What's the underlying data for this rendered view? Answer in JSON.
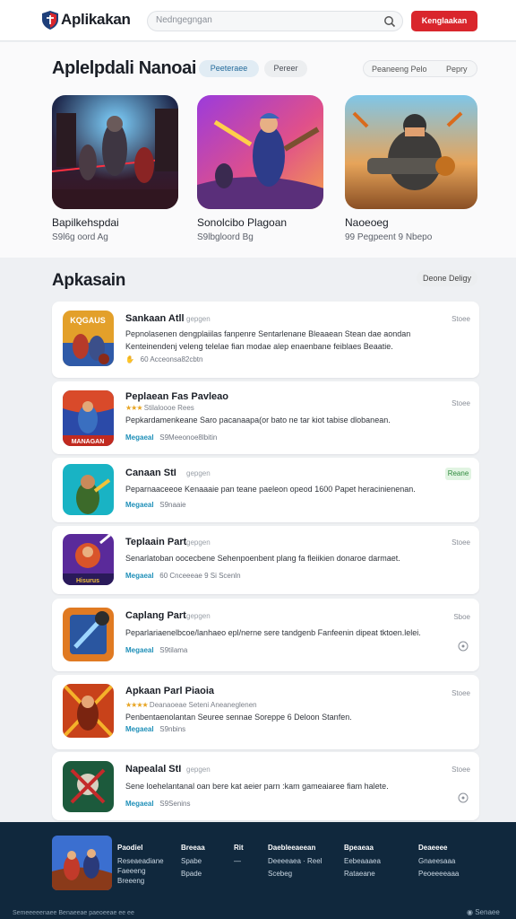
{
  "header": {
    "brand": "Aplikakan",
    "search_placeholder": "Nedngegngan",
    "cta_label": "Kenglaakan"
  },
  "featured": {
    "title": "Aplelpdali Nanoai",
    "pill_active": "Peeteraee",
    "pill_inactive": "Pereer",
    "sort_left": "Peaneeng Pelo",
    "sort_right": "Pepry",
    "cards": [
      {
        "title": "Bapilkehspdai",
        "subtitle": "S9l6g oord Ag"
      },
      {
        "title": "Sonolcibo Plagoan",
        "subtitle": "S9lbgloord Bg"
      },
      {
        "title": "Naoeoeg",
        "subtitle": "99 Pegpeent 9 Nbepo"
      }
    ]
  },
  "list": {
    "title": "Apkasain",
    "sort_label": "Deone Deligy",
    "rows": [
      {
        "icon_label": "KQGAUS",
        "title": "Sankaan Atll",
        "tag": "gepgen",
        "right": "Stoee",
        "desc1": "Pepnolasenen dengplaiilas fanpenre Sentarlenane Bleaaean Stean dae aondan",
        "desc2": "Kenteinendenj veleng telelae fian modae alep enaenbane feiblaes Beaatie.",
        "meta_a": "✋",
        "meta_b": "60 Acceonsa82cbtn"
      },
      {
        "icon_label": "MANAGAN",
        "title": "Peplaean Fas Pavleao",
        "tag": "",
        "right": "Stoee",
        "stars": "★★★",
        "rating": "Stilaloooe Rees",
        "desc1": "Pepkardamenkeane Saro pacanaapa(or bato ne tar kiot tabise dlobanean.",
        "desc2": "",
        "meta_a": "Megaeal",
        "meta_b": "S9Meeonoe8lbitin"
      },
      {
        "icon_label": "",
        "title": "Canaan StI",
        "tag": "gepgen",
        "right": "Reane",
        "desc1": "Peparnaaceeoe Kenaaaie pan teane paeleon opeod 1600 Papet heracinienenan.",
        "desc2": "",
        "meta_a": "Megaeal",
        "meta_b": "S9naaie"
      },
      {
        "icon_label": "Hisurus",
        "title": "Teplaain Part",
        "tag": "gepgen",
        "right": "Stoee",
        "desc1": "Senarlatoban oocecbene Sehenpoenbent plang fa fleiikien donaroe darmaet.",
        "desc2": "",
        "meta_a": "Megaeal",
        "meta_b": "60 Cnceeeae 9 Si Scenln"
      },
      {
        "icon_label": "",
        "title": "Caplang Part",
        "tag": "gepgen",
        "right": "Sboe",
        "desc1": "Peparlariaenelbcoe/lanhaeo epl/nerne sere tandgenb Fanfeenin dipeat tktoen.lelei.",
        "desc2": "",
        "meta_a": "Megaeal",
        "meta_b": "S9tilama"
      },
      {
        "icon_label": "",
        "title": "Apkaan Parl Piaoia",
        "tag": "",
        "right": "Stoee",
        "stars": "★★★★",
        "rating": "Deanaoeae Seteni Aneaneglenen",
        "desc1": "Penbentaenolantan Seuree sennae Soreppe 6 Deloon Stanfen.",
        "desc2": "",
        "meta_a": "Megaeal",
        "meta_b": "S9nbins"
      },
      {
        "icon_label": "",
        "title": "Napealal StI",
        "tag": "gepgen",
        "right": "Stoee",
        "desc1": "Sene loehelantanal oan bere kat aeier parn :kam gameaiaree fiam halete.",
        "desc2": "",
        "meta_a": "Megaeal",
        "meta_b": "S9Senins"
      }
    ]
  },
  "footer": {
    "app_name": "Paodiel",
    "app_line1": "Reseaeadiane",
    "app_line2": "Faeeeng",
    "app_line3": "Breeeng",
    "cols": [
      {
        "h": "Breeaa",
        "items": [
          "Spabe",
          "Bpade"
        ]
      },
      {
        "h": "Rit",
        "items": [
          "—"
        ]
      },
      {
        "h": "Daebleeaeean",
        "items": [
          "Deeeeaea · Reel",
          "Scebeg"
        ]
      },
      {
        "h": "Bpeaeaa",
        "items": [
          "Eebeaaaea",
          "Rataeane"
        ]
      },
      {
        "h": "Deaeeee",
        "items": [
          "Gnaeesaaa",
          "Peoeeeeaaa"
        ]
      }
    ],
    "copyright": "Semeeeeenaee Benaeeae paeoeeae ee ee",
    "language": "Senaee"
  }
}
